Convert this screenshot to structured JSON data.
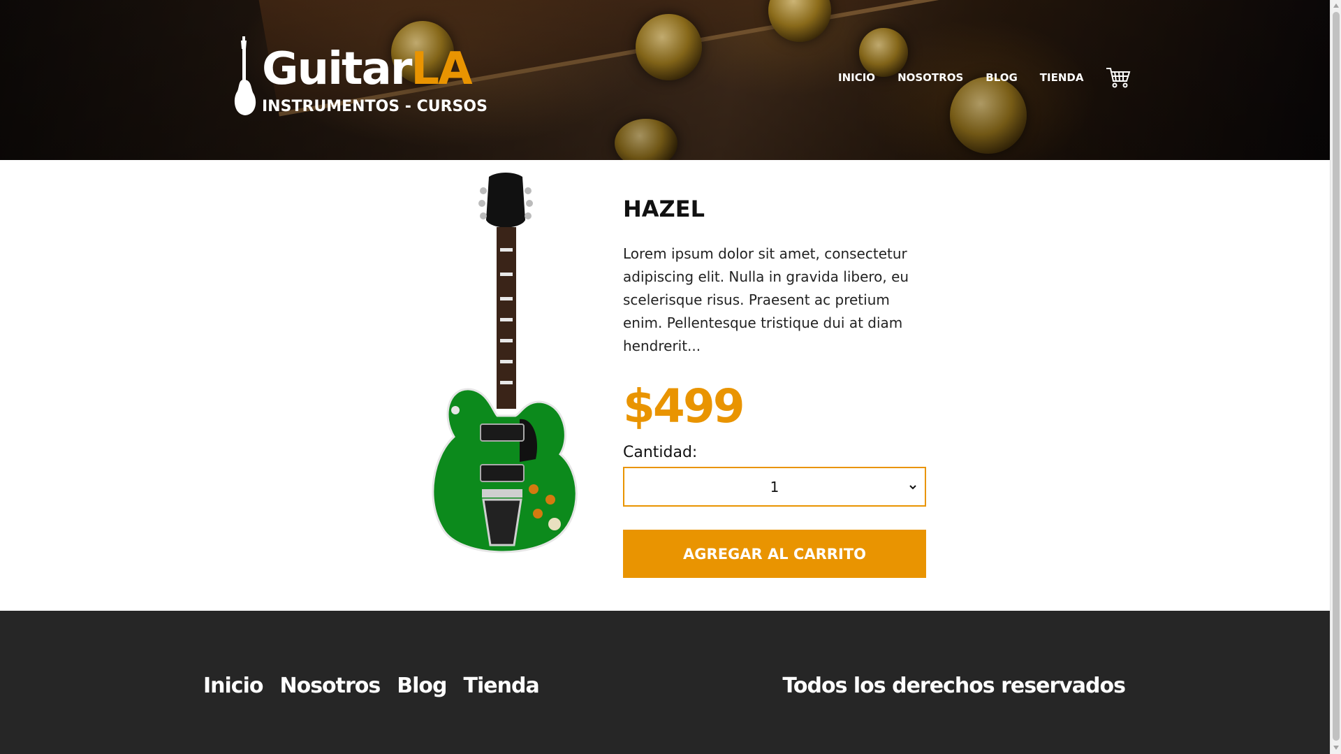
{
  "header": {
    "logo": {
      "word": "Guitar",
      "accent": "LA",
      "tagline": "INSTRUMENTOS - CURSOS"
    },
    "nav": [
      {
        "label": "INICIO"
      },
      {
        "label": "NOSOTROS"
      },
      {
        "label": "BLOG"
      },
      {
        "label": "TIENDA"
      }
    ],
    "cart_icon": "shopping-cart-icon"
  },
  "product": {
    "image_icon": "electric-guitar-image",
    "name": "HAZEL",
    "description": "Lorem ipsum dolor sit amet, consectetur adipiscing elit. Nulla in gravida libero, eu scelerisque risus. Praesent ac pretium enim. Pellentesque tristique dui at diam hendrerit...",
    "price": "$499",
    "quantity_label": "Cantidad:",
    "quantity_value": "1",
    "add_button": "AGREGAR AL CARRITO"
  },
  "footer": {
    "nav": [
      {
        "label": "Inicio"
      },
      {
        "label": "Nosotros"
      },
      {
        "label": "Blog"
      },
      {
        "label": "Tienda"
      }
    ],
    "copyright": "Todos los derechos reservados"
  },
  "colors": {
    "accent": "#e99401",
    "footer_bg": "#262626",
    "text": "#111111",
    "guitar_body": "#0c8a1c"
  }
}
